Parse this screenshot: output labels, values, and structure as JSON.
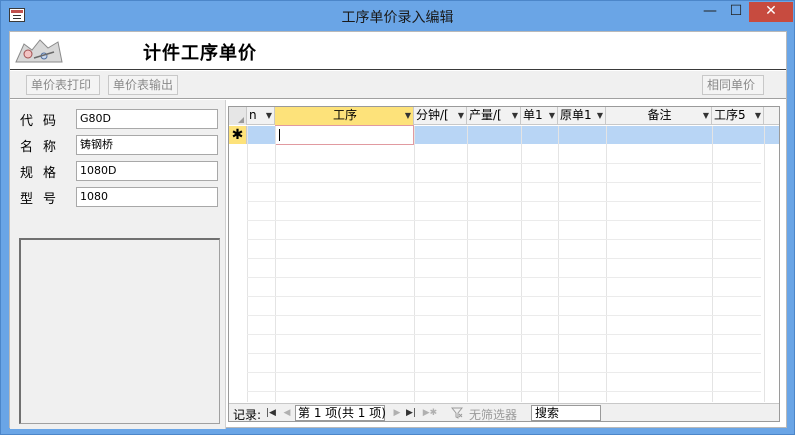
{
  "window": {
    "title": "工序单价录入编辑",
    "min_glyph": "—",
    "max_glyph": "☐",
    "close_glyph": "✕"
  },
  "header": {
    "form_title": "计件工序单价"
  },
  "toolbar": {
    "print_label": "单价表打印",
    "export_label": "单价表输出",
    "same_price_label": "相同单价"
  },
  "fields": [
    {
      "label": "代码",
      "value": "G80D"
    },
    {
      "label": "名称",
      "value": "铸钢桥"
    },
    {
      "label": "规格",
      "value": "1080D"
    },
    {
      "label": "型号",
      "value": "1080"
    }
  ],
  "grid": {
    "columns": [
      {
        "label": "n"
      },
      {
        "label": "工序"
      },
      {
        "label": "分钟/["
      },
      {
        "label": "产量/["
      },
      {
        "label": "单1"
      },
      {
        "label": "原单1"
      },
      {
        "label": "备注"
      },
      {
        "label": "工序5"
      }
    ],
    "new_row_marker": "✱"
  },
  "navbar": {
    "label": "记录:",
    "first": "|◀",
    "prev": "◀",
    "position": "第 1 项(共 1 项)",
    "next": "▶",
    "last": "▶|",
    "new": "▶✱",
    "filter_text": "无筛选器",
    "search_text": "搜索"
  },
  "colors": {
    "title_bg": "#6aa5e6",
    "active_header": "#fde27a",
    "selected_row": "#b8d5f5",
    "close_button": "#c74b3f"
  }
}
